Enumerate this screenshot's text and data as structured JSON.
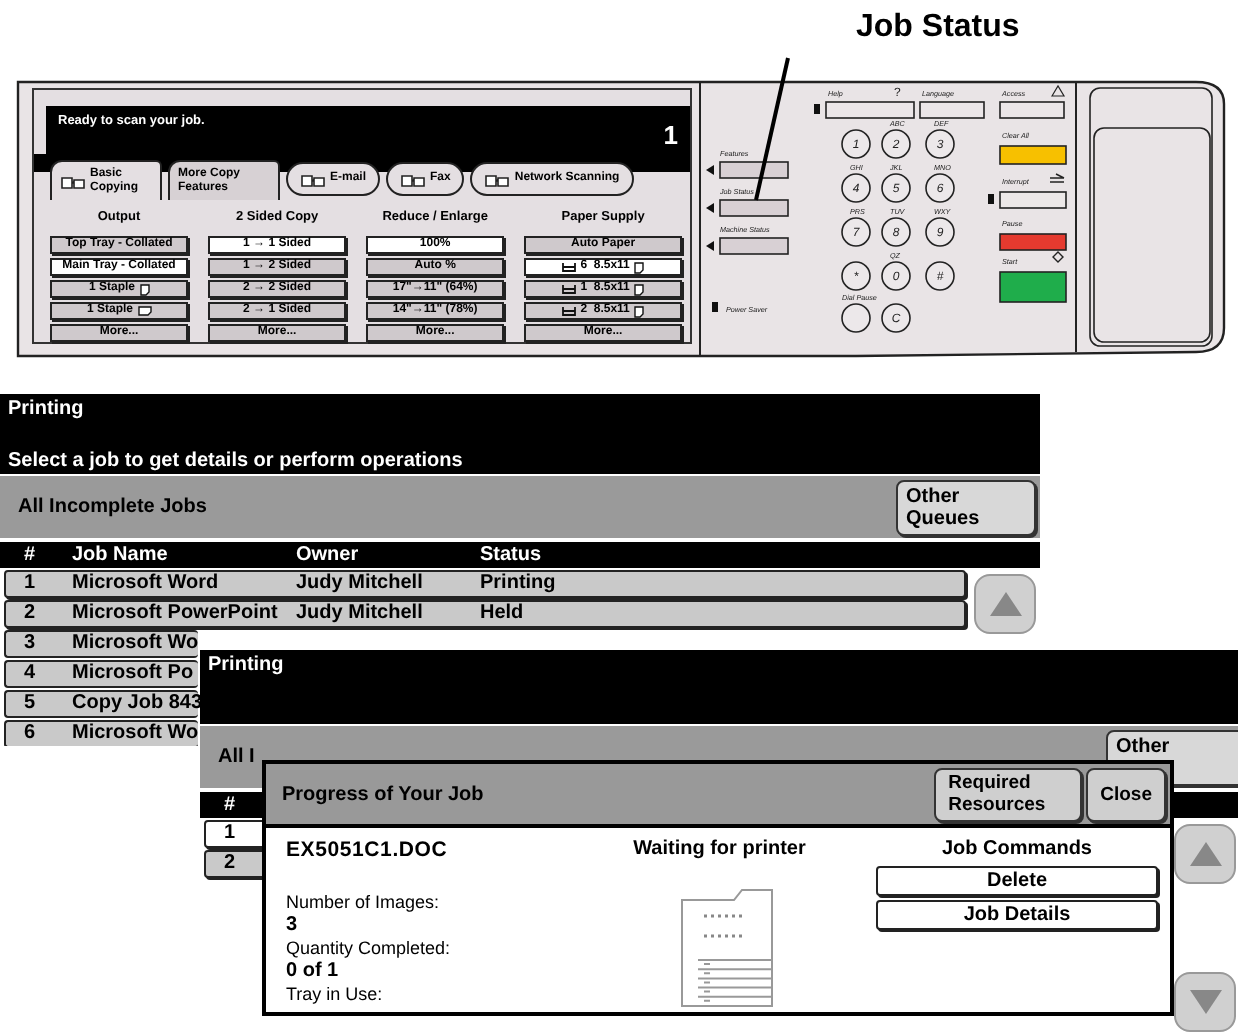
{
  "callout": {
    "label": "Job Status"
  },
  "control_panel": {
    "screen": {
      "message": "Ready to scan your job.",
      "quantity": "1",
      "tabs": [
        {
          "label": "Basic Copying",
          "kind": "folder",
          "selected": true
        },
        {
          "label": "More Copy Features",
          "kind": "folder",
          "selected": false
        },
        {
          "label": "E-mail",
          "kind": "pill",
          "selected": false
        },
        {
          "label": "Fax",
          "kind": "pill",
          "selected": false
        },
        {
          "label": "Network Scanning",
          "kind": "pill",
          "selected": false
        }
      ],
      "columns": [
        {
          "heading": "Output",
          "options": [
            {
              "label": "Top Tray - Collated",
              "selected": false
            },
            {
              "label": "Main Tray - Collated",
              "selected": true
            },
            {
              "label": "1 Staple",
              "selected": false,
              "kind": "portrait"
            },
            {
              "label": "1 Staple",
              "selected": false,
              "kind": "landscape"
            },
            {
              "label": "More...",
              "selected": false
            }
          ]
        },
        {
          "heading": "2 Sided Copy",
          "options": [
            {
              "label": "1 → 1 Sided",
              "selected": true
            },
            {
              "label": "1 → 2 Sided",
              "selected": false
            },
            {
              "label": "2 → 2 Sided",
              "selected": false
            },
            {
              "label": "2 → 1 Sided",
              "selected": false
            },
            {
              "label": "More...",
              "selected": false
            }
          ]
        },
        {
          "heading": "Reduce / Enlarge",
          "options": [
            {
              "label": "100%",
              "selected": true
            },
            {
              "label": "Auto %",
              "selected": false
            },
            {
              "label": "17\"→11\" (64%)",
              "selected": false
            },
            {
              "label": "14\"→11\" (78%)",
              "selected": false
            },
            {
              "label": "More...",
              "selected": false
            }
          ]
        },
        {
          "heading": "Paper Supply",
          "options": [
            {
              "label": "Auto Paper",
              "selected": false
            },
            {
              "label": "6  8.5x11",
              "selected": true,
              "kind": "tray"
            },
            {
              "label": "1  8.5x11",
              "selected": false,
              "kind": "tray"
            },
            {
              "label": "2  8.5x11",
              "selected": false,
              "kind": "tray"
            },
            {
              "label": "More...",
              "selected": false
            }
          ]
        }
      ]
    },
    "side_buttons": [
      {
        "label": "Features"
      },
      {
        "label": "Job Status"
      },
      {
        "label": "Machine Status"
      }
    ],
    "top_buttons": [
      {
        "label": "Help",
        "symbol": "?"
      },
      {
        "label": "Language"
      },
      {
        "label": "Access"
      }
    ],
    "keypad": [
      {
        "digit": "1"
      },
      {
        "digit": "2",
        "letters": "ABC"
      },
      {
        "digit": "3",
        "letters": "DEF"
      },
      {
        "digit": "4",
        "letters": "GHI"
      },
      {
        "digit": "5",
        "letters": "JKL"
      },
      {
        "digit": "6",
        "letters": "MNO"
      },
      {
        "digit": "7",
        "letters": "PRS"
      },
      {
        "digit": "8",
        "letters": "TUV"
      },
      {
        "digit": "9",
        "letters": "WXY"
      },
      {
        "digit": "*"
      },
      {
        "digit": "0",
        "letters": "QZ"
      },
      {
        "digit": "#"
      },
      {
        "label": "Dial Pause"
      },
      {
        "digit": "C"
      }
    ],
    "function_keys": [
      {
        "label": "Clear All",
        "color": "#f7c000"
      },
      {
        "label": "Interrupt",
        "color": "#ece8e8"
      },
      {
        "label": "Pause",
        "color": "#e53a2f"
      },
      {
        "label": "Start",
        "color": "#1fad4b"
      }
    ],
    "power_saver": {
      "label": "Power Saver"
    }
  },
  "print_queue": {
    "title": "Printing",
    "instruction": "Select a job to get details or perform operations",
    "queue": "All Incomplete Jobs",
    "other_button": "Other Queues",
    "columns": [
      "#",
      "Job Name",
      "Owner",
      "Status"
    ],
    "rows": [
      {
        "number": "1",
        "name": "Microsoft Word",
        "owner": "Judy Mitchell",
        "status": "Printing",
        "selected": false
      },
      {
        "number": "2",
        "name": "Microsoft PowerPoint",
        "owner": "Judy Mitchell",
        "status": "Held",
        "selected": false
      },
      {
        "number": "3",
        "name": "Microsoft Wo",
        "selected": false
      },
      {
        "number": "4",
        "name": "Microsoft Po",
        "selected": false
      },
      {
        "number": "5",
        "name": "Copy Job 843",
        "selected": false
      },
      {
        "number": "6",
        "name": "Microsoft Wo",
        "selected": false
      }
    ]
  },
  "job_screen": {
    "title": "Printing",
    "queue": "All I",
    "other_button": "Other",
    "columns": [
      "#"
    ],
    "rows": [
      {
        "number": "1",
        "selected": true
      },
      {
        "number": "2",
        "selected": false
      }
    ],
    "dialog": {
      "title": "Progress of Your Job",
      "buttons": [
        "Required Resources",
        "Close"
      ],
      "document": "EX5051C1.DOC",
      "status": "Waiting for printer",
      "fields": [
        {
          "label": "Number of Images:",
          "value": "3"
        },
        {
          "label": "Quantity Completed:",
          "value": "0 of 1"
        },
        {
          "label": "Tray in Use:"
        }
      ],
      "commands_heading": "Job Commands",
      "commands": [
        "Delete",
        "Job Details"
      ]
    }
  }
}
